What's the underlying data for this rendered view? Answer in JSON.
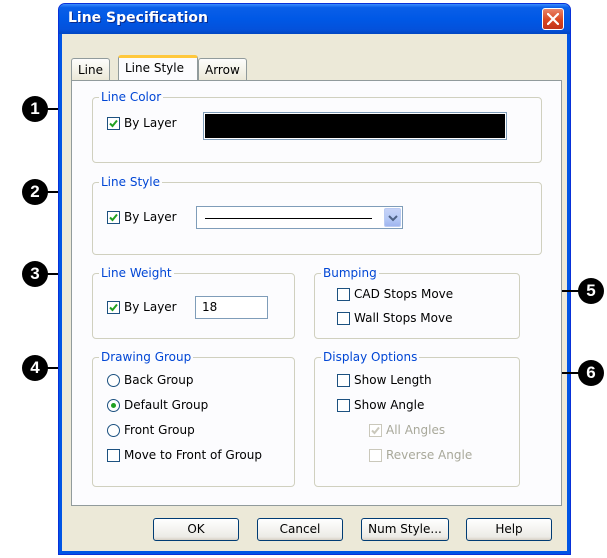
{
  "dialog": {
    "title": "Line Specification",
    "close_icon": "close-x-icon"
  },
  "tabs": [
    {
      "label": "Line",
      "active": false
    },
    {
      "label": "Line Style",
      "active": true
    },
    {
      "label": "Arrow",
      "active": false
    }
  ],
  "line_color": {
    "legend": "Line Color",
    "by_layer_label": "By Layer",
    "by_layer_checked": true,
    "swatch_color": "#000000"
  },
  "line_style": {
    "legend": "Line Style",
    "by_layer_label": "By Layer",
    "by_layer_checked": true,
    "selected_style": "solid"
  },
  "line_weight": {
    "legend": "Line Weight",
    "by_layer_label": "By Layer",
    "by_layer_checked": true,
    "value": "18"
  },
  "bumping": {
    "legend": "Bumping",
    "cad_stops_move": "CAD Stops Move",
    "wall_stops_move": "Wall Stops Move"
  },
  "drawing_group": {
    "legend": "Drawing Group",
    "back_group": "Back Group",
    "default_group": "Default Group",
    "front_group": "Front Group",
    "selected": "Default Group",
    "move_to_front": "Move to Front of Group"
  },
  "display_options": {
    "legend": "Display Options",
    "show_length": "Show Length",
    "show_angle": "Show Angle",
    "all_angles": "All Angles",
    "all_angles_checked": true,
    "reverse_angle": "Reverse Angle"
  },
  "buttons": {
    "ok": "OK",
    "cancel": "Cancel",
    "num_style": "Num Style...",
    "help": "Help"
  },
  "callouts": [
    "1",
    "2",
    "3",
    "4",
    "5",
    "6"
  ]
}
